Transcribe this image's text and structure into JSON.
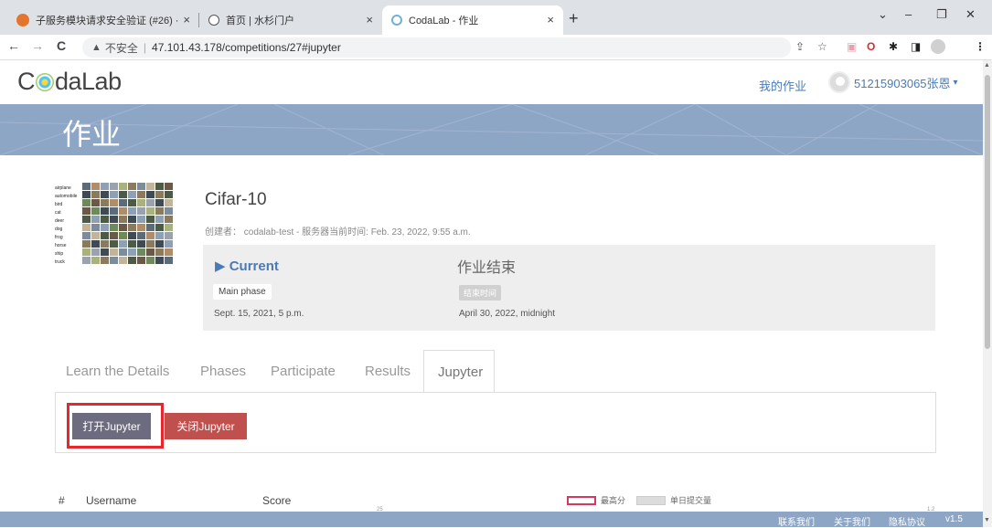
{
  "browser": {
    "tabs": [
      {
        "title": "子服务模块请求安全验证 (#26) · ",
        "close": "×",
        "favicon_color": "#e2762d"
      },
      {
        "title": "首页 | 水杉门户",
        "close": "×",
        "favicon_color": "#555555"
      },
      {
        "title": "CodaLab - 作业",
        "close": "×",
        "favicon_color": "#6fb2d8"
      }
    ],
    "new_tab": "+",
    "window_controls": {
      "dropdown": "⌄",
      "minimize": "–",
      "restore": "❐",
      "close": "✕"
    },
    "nav": {
      "back": "←",
      "forward": "→",
      "reload": "C"
    },
    "address": {
      "warning_icon": "▲",
      "insecure_label": "不安全",
      "separator": "|",
      "url": "47.101.43.178/competitions/27#jupyter"
    },
    "extensions": [
      "share-icon",
      "star-icon",
      "ext-red-icon",
      "opera-icon",
      "puzzle-icon",
      "sidepanel-icon",
      "profile-icon",
      "menu-icon"
    ]
  },
  "header": {
    "logo_prefix": "C",
    "logo_suffix": "daLab",
    "my_work": "我的作业",
    "username": "51215903065张恩",
    "user_caret": "▾"
  },
  "banner": {
    "title": "作业"
  },
  "competition": {
    "image_labels": [
      "airplane",
      "automobile",
      "bird",
      "cat",
      "deer",
      "dog",
      "frog",
      "horse",
      "ship",
      "truck"
    ],
    "title": "Cifar-10",
    "meta": "创建者： codalab-test - 服务器当前时间: Feb. 23, 2022, 9:55 a.m."
  },
  "phases": {
    "current_label": "▶ Current",
    "phase_name": "Main phase",
    "start_date": "Sept. 15, 2021, 5 p.m.",
    "end_title": "作业结束",
    "end_badge": "结束时间",
    "end_date": "April 30, 2022, midnight"
  },
  "tabs": [
    {
      "label": "Learn the Details",
      "active": false
    },
    {
      "label": "Phases",
      "active": false
    },
    {
      "label": "Participate",
      "active": false
    },
    {
      "label": "Results",
      "active": false
    },
    {
      "label": "Jupyter",
      "active": true
    }
  ],
  "jupyter": {
    "open_label": "打开Jupyter",
    "close_label": "关闭Jupyter"
  },
  "results_table": {
    "headers": [
      "#",
      "Username",
      "Score"
    ],
    "axis_left_tick": "25",
    "axis_right_tick": "1.2",
    "legend": [
      {
        "label": "最高分",
        "color": "#d4395f",
        "style": "outline"
      },
      {
        "label": "单日提交量",
        "color": "#dcdcdc",
        "style": "fill"
      }
    ]
  },
  "footer": {
    "links": [
      "联系我们",
      "关于我们",
      "隐私协议"
    ],
    "version": "v1.5"
  },
  "colors": {
    "brand_blue": "#8ea6c6",
    "link_blue": "#4a7bb7",
    "open_button": "#6d6b80",
    "close_button": "#c0504d",
    "highlight": "#e8262e"
  }
}
